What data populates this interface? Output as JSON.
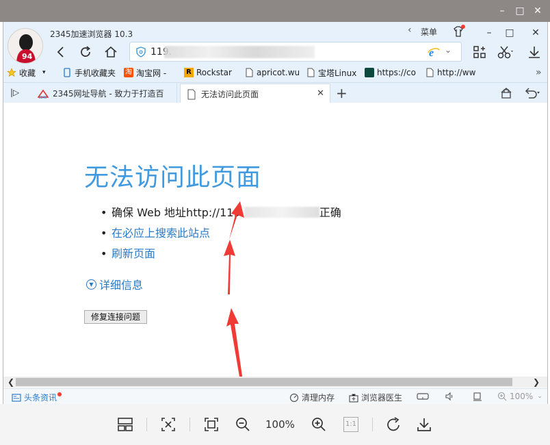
{
  "browser": {
    "title": "2345加速浏览器 10.3",
    "menu_label": "菜单",
    "address_visible": "119.",
    "avatar_number": "94"
  },
  "bookmarks": [
    {
      "label": "收藏",
      "icon": "star-folder-icon"
    },
    {
      "label": "手机收藏夹",
      "icon": "mobile-icon"
    },
    {
      "label": "淘宝网 -",
      "icon": "taobao-icon"
    },
    {
      "label": "Rockstar",
      "icon": "rockstar-icon"
    },
    {
      "label": "apricot.wu",
      "icon": "page-icon"
    },
    {
      "label": "宝塔Linux",
      "icon": "page-icon"
    },
    {
      "label": "https://co",
      "icon": "site-icon"
    },
    {
      "label": "http://ww",
      "icon": "page-icon"
    }
  ],
  "tabs": [
    {
      "label": "2345网址导航 - 致力于打造百",
      "active": false
    },
    {
      "label": "无法访问此页面",
      "active": true
    }
  ],
  "page": {
    "title": "无法访问此页面",
    "item1_prefix": "确保 Web 地址http://119.",
    "item1_suffix": "正确",
    "item2": "在必应上搜索此站点",
    "item3": "刷新页面",
    "details": "详细信息",
    "fix_button": "修复连接问题"
  },
  "status": {
    "news": "头条资讯",
    "clean_memory": "清理内存",
    "doctor": "浏览器医生",
    "zoom": "100%"
  },
  "viewer": {
    "zoom": "100%",
    "actual_size": "1:1"
  },
  "colors": {
    "title_blue": "#3f9ae0",
    "link_blue": "#2a7ac8",
    "chrome_bg": "#e6f1fb",
    "arrow_red": "#ee3b36"
  }
}
